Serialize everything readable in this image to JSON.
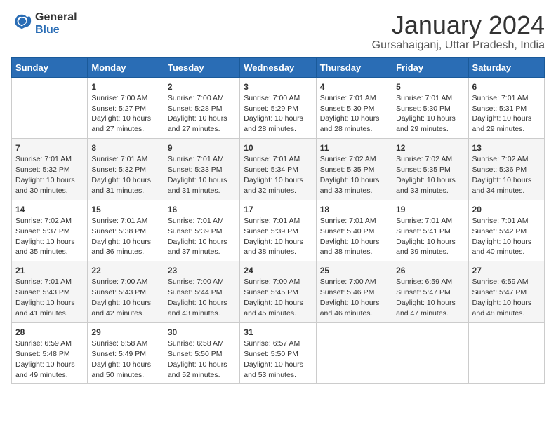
{
  "header": {
    "logo_general": "General",
    "logo_blue": "Blue",
    "month_year": "January 2024",
    "location": "Gursahaiganj, Uttar Pradesh, India"
  },
  "days_of_week": [
    "Sunday",
    "Monday",
    "Tuesday",
    "Wednesday",
    "Thursday",
    "Friday",
    "Saturday"
  ],
  "weeks": [
    [
      {
        "day": "",
        "content": ""
      },
      {
        "day": "1",
        "content": "Sunrise: 7:00 AM\nSunset: 5:27 PM\nDaylight: 10 hours\nand 27 minutes."
      },
      {
        "day": "2",
        "content": "Sunrise: 7:00 AM\nSunset: 5:28 PM\nDaylight: 10 hours\nand 27 minutes."
      },
      {
        "day": "3",
        "content": "Sunrise: 7:00 AM\nSunset: 5:29 PM\nDaylight: 10 hours\nand 28 minutes."
      },
      {
        "day": "4",
        "content": "Sunrise: 7:01 AM\nSunset: 5:30 PM\nDaylight: 10 hours\nand 28 minutes."
      },
      {
        "day": "5",
        "content": "Sunrise: 7:01 AM\nSunset: 5:30 PM\nDaylight: 10 hours\nand 29 minutes."
      },
      {
        "day": "6",
        "content": "Sunrise: 7:01 AM\nSunset: 5:31 PM\nDaylight: 10 hours\nand 29 minutes."
      }
    ],
    [
      {
        "day": "7",
        "content": "Sunrise: 7:01 AM\nSunset: 5:32 PM\nDaylight: 10 hours\nand 30 minutes."
      },
      {
        "day": "8",
        "content": "Sunrise: 7:01 AM\nSunset: 5:32 PM\nDaylight: 10 hours\nand 31 minutes."
      },
      {
        "day": "9",
        "content": "Sunrise: 7:01 AM\nSunset: 5:33 PM\nDaylight: 10 hours\nand 31 minutes."
      },
      {
        "day": "10",
        "content": "Sunrise: 7:01 AM\nSunset: 5:34 PM\nDaylight: 10 hours\nand 32 minutes."
      },
      {
        "day": "11",
        "content": "Sunrise: 7:02 AM\nSunset: 5:35 PM\nDaylight: 10 hours\nand 33 minutes."
      },
      {
        "day": "12",
        "content": "Sunrise: 7:02 AM\nSunset: 5:35 PM\nDaylight: 10 hours\nand 33 minutes."
      },
      {
        "day": "13",
        "content": "Sunrise: 7:02 AM\nSunset: 5:36 PM\nDaylight: 10 hours\nand 34 minutes."
      }
    ],
    [
      {
        "day": "14",
        "content": "Sunrise: 7:02 AM\nSunset: 5:37 PM\nDaylight: 10 hours\nand 35 minutes."
      },
      {
        "day": "15",
        "content": "Sunrise: 7:01 AM\nSunset: 5:38 PM\nDaylight: 10 hours\nand 36 minutes."
      },
      {
        "day": "16",
        "content": "Sunrise: 7:01 AM\nSunset: 5:39 PM\nDaylight: 10 hours\nand 37 minutes."
      },
      {
        "day": "17",
        "content": "Sunrise: 7:01 AM\nSunset: 5:39 PM\nDaylight: 10 hours\nand 38 minutes."
      },
      {
        "day": "18",
        "content": "Sunrise: 7:01 AM\nSunset: 5:40 PM\nDaylight: 10 hours\nand 38 minutes."
      },
      {
        "day": "19",
        "content": "Sunrise: 7:01 AM\nSunset: 5:41 PM\nDaylight: 10 hours\nand 39 minutes."
      },
      {
        "day": "20",
        "content": "Sunrise: 7:01 AM\nSunset: 5:42 PM\nDaylight: 10 hours\nand 40 minutes."
      }
    ],
    [
      {
        "day": "21",
        "content": "Sunrise: 7:01 AM\nSunset: 5:43 PM\nDaylight: 10 hours\nand 41 minutes."
      },
      {
        "day": "22",
        "content": "Sunrise: 7:00 AM\nSunset: 5:43 PM\nDaylight: 10 hours\nand 42 minutes."
      },
      {
        "day": "23",
        "content": "Sunrise: 7:00 AM\nSunset: 5:44 PM\nDaylight: 10 hours\nand 43 minutes."
      },
      {
        "day": "24",
        "content": "Sunrise: 7:00 AM\nSunset: 5:45 PM\nDaylight: 10 hours\nand 45 minutes."
      },
      {
        "day": "25",
        "content": "Sunrise: 7:00 AM\nSunset: 5:46 PM\nDaylight: 10 hours\nand 46 minutes."
      },
      {
        "day": "26",
        "content": "Sunrise: 6:59 AM\nSunset: 5:47 PM\nDaylight: 10 hours\nand 47 minutes."
      },
      {
        "day": "27",
        "content": "Sunrise: 6:59 AM\nSunset: 5:47 PM\nDaylight: 10 hours\nand 48 minutes."
      }
    ],
    [
      {
        "day": "28",
        "content": "Sunrise: 6:59 AM\nSunset: 5:48 PM\nDaylight: 10 hours\nand 49 minutes."
      },
      {
        "day": "29",
        "content": "Sunrise: 6:58 AM\nSunset: 5:49 PM\nDaylight: 10 hours\nand 50 minutes."
      },
      {
        "day": "30",
        "content": "Sunrise: 6:58 AM\nSunset: 5:50 PM\nDaylight: 10 hours\nand 52 minutes."
      },
      {
        "day": "31",
        "content": "Sunrise: 6:57 AM\nSunset: 5:50 PM\nDaylight: 10 hours\nand 53 minutes."
      },
      {
        "day": "",
        "content": ""
      },
      {
        "day": "",
        "content": ""
      },
      {
        "day": "",
        "content": ""
      }
    ]
  ]
}
